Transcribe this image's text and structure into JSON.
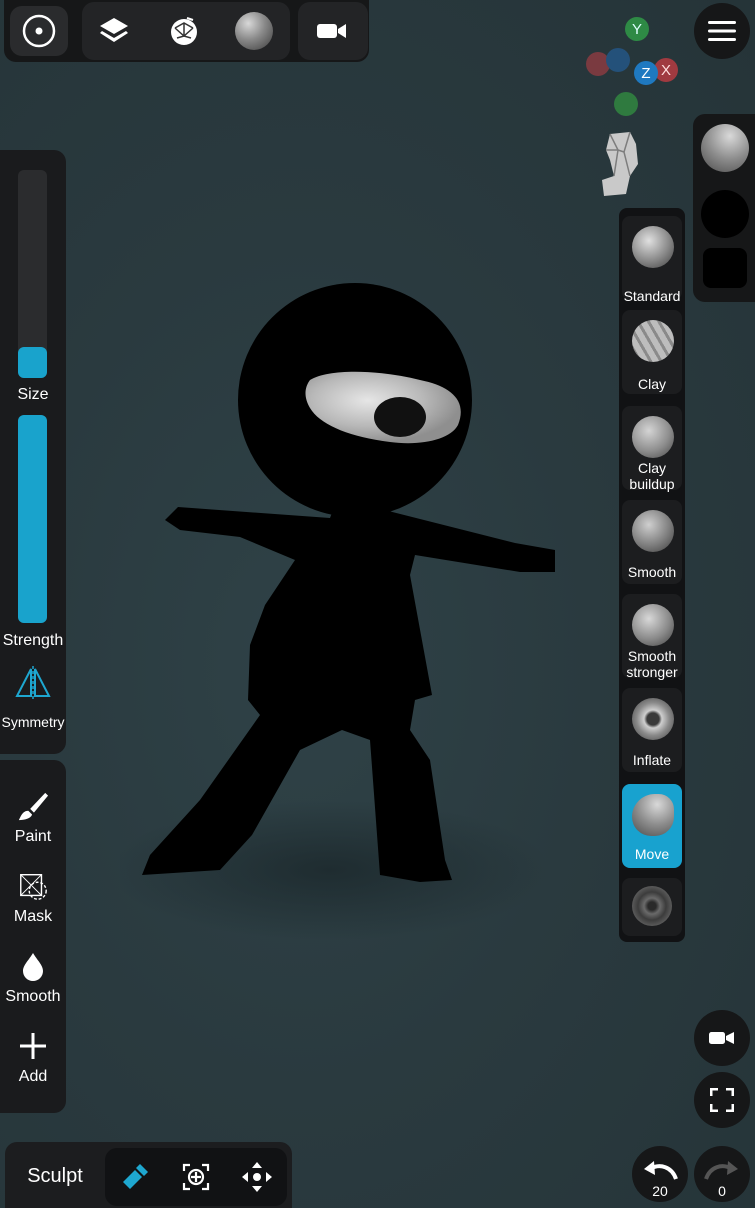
{
  "toolbar": {
    "icons": [
      "target-icon",
      "layers-icon",
      "topology-icon",
      "material-sphere-icon",
      "camera-icon"
    ]
  },
  "axes": {
    "y": "Y",
    "z": "Z",
    "x": "X"
  },
  "sliders": {
    "size_label": "Size",
    "size_value": 0.15,
    "strength_label": "Strength",
    "strength_value": 1.0
  },
  "symmetry_label": "Symmetry",
  "tools": [
    {
      "label": "Paint"
    },
    {
      "label": "Mask"
    },
    {
      "label": "Smooth"
    },
    {
      "label": "Add"
    }
  ],
  "brushes": [
    {
      "label": "Standard"
    },
    {
      "label": "Clay"
    },
    {
      "label": "Clay buildup"
    },
    {
      "label": "Smooth"
    },
    {
      "label": "Smooth stronger"
    },
    {
      "label": "Inflate"
    },
    {
      "label": "Move",
      "active": true
    },
    {
      "label": ""
    }
  ],
  "bottom": {
    "mode_label": "Sculpt",
    "undo_count": "20",
    "redo_count": "0"
  },
  "colors": {
    "accent": "#18a2cf",
    "panel": "#1b1c1e"
  }
}
